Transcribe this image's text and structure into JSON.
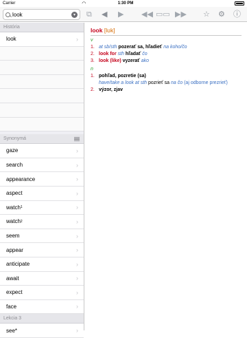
{
  "status": {
    "carrier": "Carrier",
    "time": "1:30 PM"
  },
  "search": {
    "value": "look",
    "placeholder": ""
  },
  "history": {
    "header": "História",
    "items": [
      "look"
    ]
  },
  "synonyms": {
    "header": "Synonymá",
    "items": [
      {
        "word": "gaze",
        "sup": ""
      },
      {
        "word": "search",
        "sup": ""
      },
      {
        "word": "appearance",
        "sup": ""
      },
      {
        "word": "aspect",
        "sup": ""
      },
      {
        "word": "watch",
        "sup": "1"
      },
      {
        "word": "watch",
        "sup": "2"
      },
      {
        "word": "seem",
        "sup": ""
      },
      {
        "word": "appear",
        "sup": ""
      },
      {
        "word": "anticipate",
        "sup": ""
      },
      {
        "word": "await",
        "sup": ""
      },
      {
        "word": "expect",
        "sup": ""
      },
      {
        "word": "face",
        "sup": ""
      }
    ]
  },
  "lesson": {
    "header": "Lekcia 3",
    "items": [
      "see*"
    ]
  },
  "entry": {
    "headword": "look",
    "pronunciation": "[lʊk]",
    "verb": {
      "pos": "v",
      "senses": [
        {
          "num": "1.",
          "pre": "at sb/sth",
          "main": "pozerať sa, hľadieť",
          "post": "na koho/čo"
        },
        {
          "num": "2.",
          "phrase": "look for",
          "pre": "sth",
          "main": "hľadať",
          "post": "čo"
        },
        {
          "num": "3.",
          "phrase": "look (like)",
          "pre": "",
          "main": "vyzerať",
          "post": "ako"
        }
      ]
    },
    "noun": {
      "pos": "n",
      "senses": [
        {
          "num": "1.",
          "main": "pohľad, pozretie (sa)",
          "ex_italic": "have/take a look at sth",
          "ex_main": "pozrieť",
          "ex_mid": "sa",
          "ex_italic2": "na čo",
          "ex_paren": "(aj odborne prezrieť)"
        },
        {
          "num": "2.",
          "main": "výzor, zjav"
        }
      ]
    }
  }
}
